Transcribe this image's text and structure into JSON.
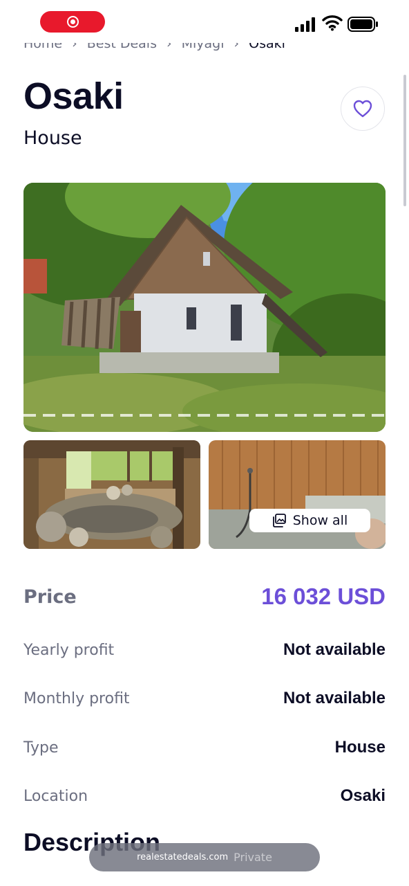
{
  "status_bar": {
    "record_indicator": "screen-recording-icon",
    "icons": [
      "signal-icon",
      "wifi-icon",
      "battery-icon"
    ]
  },
  "breadcrumb": [
    "Home",
    "Best Deals",
    "Miyagi",
    "Osaki"
  ],
  "listing": {
    "title": "Osaki",
    "subtitle": "House"
  },
  "gallery": {
    "show_all_label": "Show all"
  },
  "details": {
    "price": {
      "label": "Price",
      "value": "16 032 USD"
    },
    "rows": [
      {
        "label": "Yearly profit",
        "value": "Not available"
      },
      {
        "label": "Monthly profit",
        "value": "Not available"
      },
      {
        "label": "Type",
        "value": "House"
      },
      {
        "label": "Location",
        "value": "Osaki"
      }
    ]
  },
  "description_heading": "Description",
  "browser": {
    "url": "realestatedeals.com",
    "mode": "Private"
  },
  "colors": {
    "accent": "#6c4fd8",
    "text": "#0c0d25",
    "muted": "#6b6e80",
    "record": "#e8192c"
  }
}
